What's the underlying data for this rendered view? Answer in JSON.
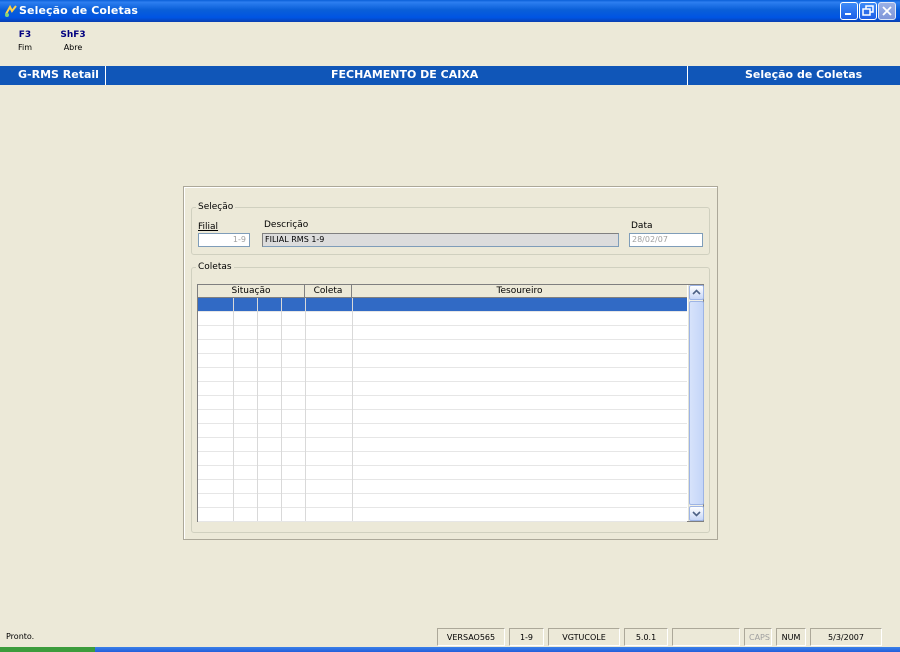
{
  "window": {
    "title": "Seleção de Coletas"
  },
  "fkeys": [
    {
      "key": "F3",
      "label": "Fim"
    },
    {
      "key": "ShF3",
      "label": "Abre"
    }
  ],
  "header": {
    "app": "G-RMS Retail",
    "module": "FECHAMENTO DE CAIXA",
    "screen": "Seleção de Coletas",
    "color": "#1056b8"
  },
  "selecao": {
    "legend": "Seleção",
    "filial_label": "Filial",
    "filial_value": "1-9",
    "descricao_label": "Descrição",
    "descricao_value": "FILIAL RMS 1-9",
    "data_label": "Data",
    "data_value": "28/02/07"
  },
  "coletas": {
    "legend": "Coletas",
    "columns": [
      "Situação",
      "Coleta",
      "Tesoureiro"
    ],
    "selected_color": "#316ac5"
  },
  "statusbar": {
    "message": "Pronto.",
    "version": "VERSAO565",
    "branch": "1-9",
    "program": "VGTUCOLE",
    "release": "5.0.1",
    "caps": "CAPS",
    "num": "NUM",
    "date": "5/3/2007"
  }
}
